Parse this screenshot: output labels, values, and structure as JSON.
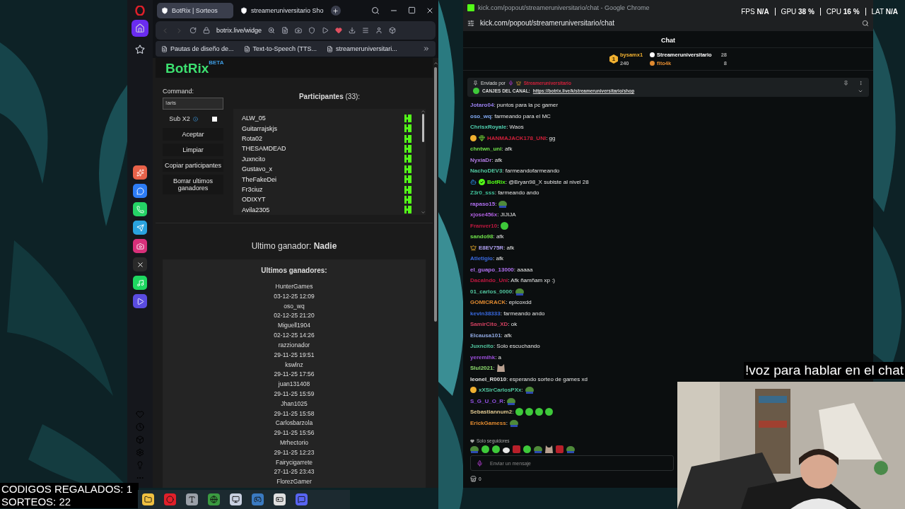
{
  "opera": {
    "sidebar_top": [
      {
        "kind": "home",
        "selected": true
      },
      {
        "kind": "star",
        "selected": false
      }
    ],
    "sidebar_apps": [
      {
        "kind": "aria",
        "color": "#e8624a"
      },
      {
        "kind": "messenger",
        "color": "#2d7cf6"
      },
      {
        "kind": "whatsapp",
        "color": "#25d366"
      },
      {
        "kind": "telegram",
        "color": "#2aa3e0"
      },
      {
        "kind": "instagram",
        "color": "#d8307a"
      },
      {
        "kind": "x",
        "color": "#2a2a2a"
      },
      {
        "kind": "spotify",
        "color": "#1ed760"
      },
      {
        "kind": "player",
        "color": "#5a4ce0"
      }
    ],
    "tabs": [
      {
        "title": "BotRix | Sorteos",
        "selected": true
      },
      {
        "title": "streameruniversitario Sho",
        "selected": false
      }
    ],
    "address": "botrix.live/widge",
    "bookmarks": [
      "Pautas de diseño de...",
      "Text-to-Speech (TTS...",
      "streameruniversitari..."
    ]
  },
  "botrix": {
    "logo": "BotRix",
    "badge": "BETA",
    "command_label": "Command:",
    "command_value": "!aris",
    "sub_label": "Sub X2",
    "sub_checked": false,
    "buttons": [
      "Aceptar",
      "Limpiar",
      "Copiar participantes",
      "Borrar ultimos ganadores"
    ],
    "participants_title": "**Participantes** (33):",
    "participants": [
      "ALW_05",
      "Guitarrajskjs",
      "Rota02",
      "THESAMDEAD",
      "Juxncito",
      "Gustavo_x",
      "TheFakeDei",
      "Fr3ciuz",
      "ODIXYT",
      "Avila2305"
    ],
    "last_winner": "Ultimo ganador: **Nadie**",
    "winners_title": "Ultimos ganadores:",
    "winners": [
      {
        "name": "HunterGames",
        "date": "03-12-25 12:09"
      },
      {
        "name": "oso_wq",
        "date": "02-12-25 21:20"
      },
      {
        "name": "Miguell1904",
        "date": "02-12-25 14:26"
      },
      {
        "name": "razzionador",
        "date": "29-11-25 19:51"
      },
      {
        "name": "kswlnz",
        "date": "29-11-25 17:56"
      },
      {
        "name": "juan131408",
        "date": "29-11-25 15:59"
      },
      {
        "name": "Jhan1025",
        "date": "29-11-25 15:58"
      },
      {
        "name": "Carlosbarzola",
        "date": "29-11-25 15:56"
      },
      {
        "name": "Mrhectorio",
        "date": "29-11-25 12:23"
      },
      {
        "name": "Fairycigarrete",
        "date": "27-11-25 23:43"
      },
      {
        "name": "FlorezGamer"
      }
    ]
  },
  "chrome": {
    "title": "kick.com/popout/streameruniversitario/chat - Google Chrome",
    "url": "kick.com/popout/streameruniversitario/chat"
  },
  "chat": {
    "header": "Chat",
    "leaders": [
      {
        "rank": "1",
        "name": "bysamx1",
        "count": "240",
        "color": "#f0b030"
      },
      {
        "name": "Streameruniversitario",
        "count": "28",
        "color": "#ffffff"
      },
      {
        "name": "fito4k",
        "count": "8",
        "color": "#e08a30"
      }
    ],
    "pinned": {
      "sent_by": "Enviado por",
      "user": "Streameruniversitario",
      "label": "CANJES DEL CANAL:",
      "link": "https://botrix.live/k/streameruniversitario/shop"
    },
    "messages": [
      {
        "user": "Jotaro04",
        "color": "#9a80f0",
        "text": ": puntos para la pc gamer"
      },
      {
        "user": "oso_wq",
        "color": "#80a8f0",
        "text": ": farmeando para el MC"
      },
      {
        "user": "ChrisxRoyale",
        "color": "#50d0b0",
        "text": ": Waos"
      },
      {
        "user": "HANMAJACK178_UNI",
        "color": "#d0203a",
        "badges": [
          {
            "kind": "gift"
          },
          {
            "kind": "gem"
          }
        ],
        "text": ": gg"
      },
      {
        "user": "chntwn_uni",
        "color": "#6fe04a",
        "text": ": afk"
      },
      {
        "user": "NyxiaDr",
        "color": "#b07ae0",
        "text": ": afk"
      },
      {
        "user": "NachoDEV3",
        "color": "#52c7a0",
        "text": ": farmeandofarmeando"
      },
      {
        "user": "BotRix",
        "color": "#53fc18",
        "badges": [
          {
            "kind": "bot"
          },
          {
            "kind": "verified"
          }
        ],
        "text": ": @Bryan98_X subiste al nivel 28"
      },
      {
        "user": "Z3r0_sss",
        "color": "#40c098",
        "text": ": farmeando ando"
      },
      {
        "user": "rapaso15",
        "color": "#b070f0",
        "text": ":",
        "emotes": [
          {
            "kind": "frog"
          }
        ]
      },
      {
        "user": "xjose456x",
        "color": "#b060e0",
        "text": ": JIJIJA"
      },
      {
        "user": "Franver10",
        "color": "#c01840",
        "text": ":",
        "emotes": [
          {
            "kind": "blob"
          }
        ]
      },
      {
        "user": "sando98",
        "color": "#6fe04a",
        "text": ": afk"
      },
      {
        "user": "E8EV75R",
        "color": "#b0a0f0",
        "badges": [
          {
            "kind": "crown"
          }
        ],
        "text": ": afk"
      },
      {
        "user": "Atletigio",
        "color": "#3a6ae0",
        "text": ": afk"
      },
      {
        "user": "el_guapo_13000",
        "color": "#b070f0",
        "text": ": aaaaa"
      },
      {
        "user": "Dacalndo_Uni",
        "color": "#c01840",
        "text": ": Afk ñamñam xp :)"
      },
      {
        "user": "01_carlos_0000",
        "color": "#52c7a0",
        "text": ":",
        "emotes": [
          {
            "kind": "frog"
          }
        ]
      },
      {
        "user": "GOMICRACK",
        "color": "#e08a30",
        "text": ": epicoxdd"
      },
      {
        "user": "kevin38333",
        "color": "#3a6ae0",
        "text": ": farmeando ando"
      },
      {
        "user": "SamirCito_XD",
        "color": "#d04060",
        "text": ": ok"
      },
      {
        "user": "Elcausa101",
        "color": "#90a8e0",
        "text": ": afk"
      },
      {
        "user": "Juxncito",
        "color": "#52c7a0",
        "text": ": Solo escuchando"
      },
      {
        "user": "yeremihk",
        "color": "#a050e0",
        "text": ": a"
      },
      {
        "user": "Slul2021",
        "color": "#90e070",
        "text": ":",
        "emotes": [
          {
            "kind": "cat"
          }
        ]
      },
      {
        "user": "leonel_R0010",
        "color": "#e0e0e0",
        "text": ": esperando sorteo de games xd"
      },
      {
        "user": "xXSirCarlosPXx",
        "color": "#52c7a0",
        "badges": [
          {
            "kind": "gift"
          }
        ],
        "text": ":",
        "emotes": [
          {
            "kind": "frog"
          }
        ]
      },
      {
        "user": "S_G_U_O_R",
        "color": "#9050e0",
        "text": ":",
        "emotes": [
          {
            "kind": "frog"
          }
        ]
      },
      {
        "user": "Sebastiannum2",
        "color": "#e0c890",
        "text": ":",
        "emotes": [
          {
            "kind": "blob"
          },
          {
            "kind": "blob"
          },
          {
            "kind": "blob"
          },
          {
            "kind": "blob"
          }
        ]
      },
      {
        "user": "ErickGamess",
        "color": "#e08a30",
        "text": ":",
        "emotes": [
          {
            "kind": "frog"
          }
        ]
      }
    ],
    "followers_only": "Solo seguidores",
    "quick_emotes": [
      {
        "kind": "frog"
      },
      {
        "kind": "blob"
      },
      {
        "kind": "blob"
      },
      {
        "kind": "duck"
      },
      {
        "kind": "red"
      },
      {
        "kind": "blob"
      },
      {
        "kind": "frog"
      },
      {
        "kind": "cat"
      },
      {
        "kind": "red"
      },
      {
        "kind": "frog"
      }
    ],
    "placeholder": "Enviar un mensaje",
    "points": "0"
  },
  "stats": [
    {
      "label": "FPS",
      "value": "N/A"
    },
    {
      "label": "GPU",
      "value": "38 %"
    },
    {
      "label": "CPU",
      "value": "16 %"
    },
    {
      "label": "LAT",
      "value": "N/A"
    }
  ],
  "overlay_voice": "!voz para hablar en el chat",
  "overlay_counters": [
    "CODIGOS REGALADOS: 1",
    "SORTEOS: 22"
  ],
  "webcam": {
    "kind": "picture"
  },
  "taskbar": [
    {
      "kind": "folder",
      "color": "#f0c040"
    },
    {
      "kind": "opera",
      "color": "#e0202a"
    },
    {
      "kind": "text",
      "color": "#9aa0a8"
    },
    {
      "kind": "chrome",
      "color": "#3a9a40"
    },
    {
      "kind": "app",
      "color": "#c8d0e0"
    },
    {
      "kind": "steam",
      "color": "#3a7ac0"
    },
    {
      "kind": "epic",
      "color": "#e0e0e0"
    },
    {
      "kind": "discord",
      "color": "#5865f2"
    }
  ]
}
